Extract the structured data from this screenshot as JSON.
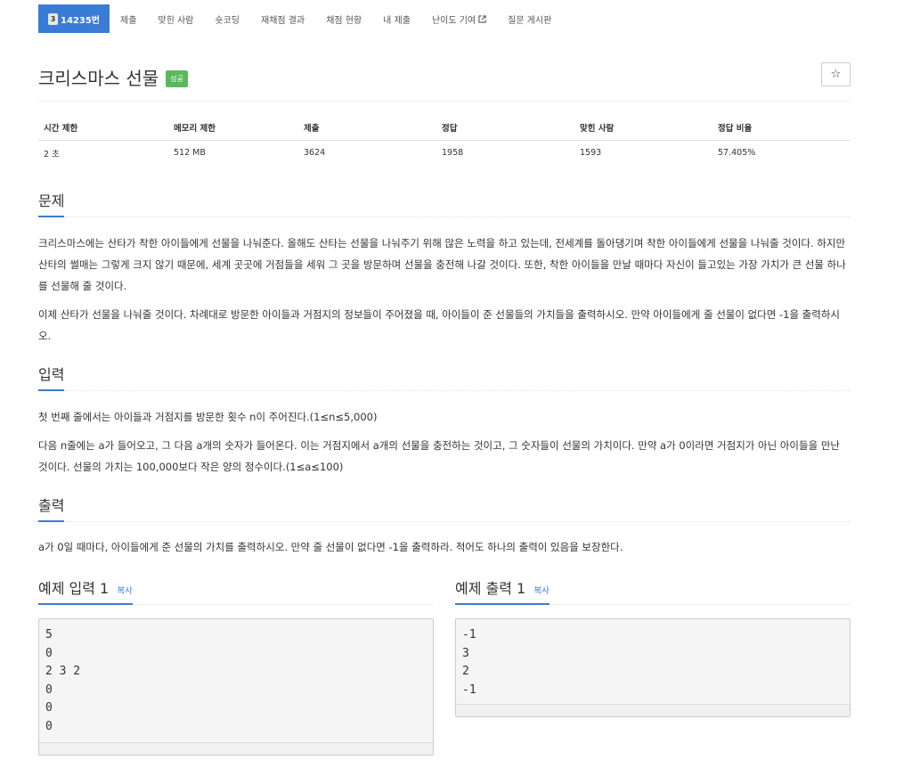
{
  "nav": {
    "problem_tab": "14235번",
    "tier": "3",
    "items": [
      "제출",
      "맞힌 사람",
      "숏코딩",
      "재채점 결과",
      "채점 현황",
      "내 제출",
      "난이도 기여",
      "질문 게시판"
    ]
  },
  "problem": {
    "title": "크리스마스 선물",
    "status_badge": "성공",
    "star": "☆"
  },
  "info_table": {
    "headers": [
      "시간 제한",
      "메모리 제한",
      "제출",
      "정답",
      "맞힌 사람",
      "정답 비율"
    ],
    "values": [
      "2 초",
      "512 MB",
      "3624",
      "1958",
      "1593",
      "57.405%"
    ]
  },
  "sections": {
    "description_title": "문제",
    "description_p1": "크리스마스에는 산타가 착한 아이들에게 선물을 나눠준다. 올해도 산타는 선물을 나눠주기 위해 많은 노력을 하고 있는데, 전세계를 돌아댕기며 착한 아이들에게 선물을 나눠줄 것이다. 하지만 산타의 썰매는 그렇게 크지 않기 때문에, 세계 곳곳에 거점들을 세워 그 곳을 방문하며 선물을 충전해 나갈 것이다. 또한, 착한 아이들을 만날 때마다 자신이 들고있는 가장 가치가 큰 선물 하나를 선물해 줄 것이다.",
    "description_p2": "이제 산타가 선물을 나눠줄 것이다. 차례대로 방문한 아이들과 거점지의 정보들이 주어졌을 때, 아이들이 준 선물들의 가치들을 출력하시오. 만약 아이들에게 줄 선물이 없다면 -1을 출력하시오.",
    "input_title": "입력",
    "input_p1": "첫 번째 줄에서는 아이들과 거점지를 방문한 횟수 n이 주어진다.(1≤n≤5,000)",
    "input_p2": "다음 n줄에는 a가 들어오고, 그 다음 a개의 숫자가 들어온다. 이는 거점지에서 a개의 선물을 충전하는 것이고, 그 숫자들이 선물의 가치이다. 만약 a가 0이라면 거점지가 아닌 아이들을 만난 것이다. 선물의 가치는 100,000보다 작은 양의 정수이다.(1≤a≤100)",
    "output_title": "출력",
    "output_p1": "a가 0일 때마다, 아이들에게 준 선물의 가치를 출력하시오. 만약 줄 선물이 없다면 -1을 출력하라. 적어도 하나의 출력이 있음을 보장한다."
  },
  "samples": {
    "input_label": "예제 입력 1",
    "output_label": "예제 출력 1",
    "copy_label": "복사",
    "input_text": "5\n0\n2 3 2\n0\n0\n0",
    "output_text": "-1\n3\n2\n-1"
  }
}
